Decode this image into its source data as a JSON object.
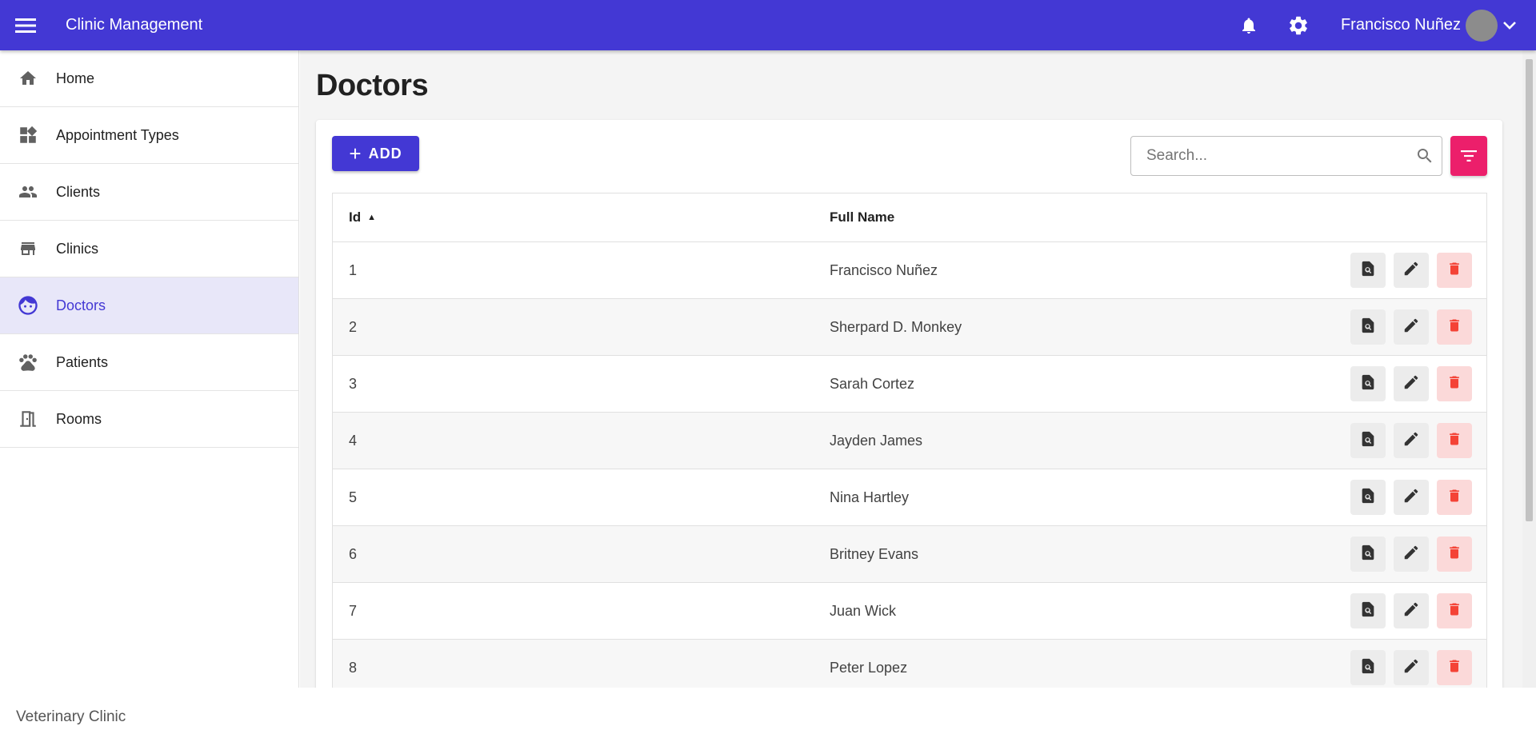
{
  "app": {
    "title": "Clinic Management"
  },
  "user": {
    "name": "Francisco Nuñez"
  },
  "sidebar": {
    "items": [
      {
        "label": "Home",
        "icon": "home-icon"
      },
      {
        "label": "Appointment Types",
        "icon": "widgets-icon"
      },
      {
        "label": "Clients",
        "icon": "people-icon"
      },
      {
        "label": "Clinics",
        "icon": "store-icon"
      },
      {
        "label": "Doctors",
        "icon": "face-icon",
        "active": true
      },
      {
        "label": "Patients",
        "icon": "paw-icon"
      },
      {
        "label": "Rooms",
        "icon": "door-icon"
      }
    ]
  },
  "page": {
    "title": "Doctors"
  },
  "toolbar": {
    "add_label": "ADD",
    "search_placeholder": "Search...",
    "search_value": ""
  },
  "table": {
    "columns": [
      "Id",
      "Full Name"
    ],
    "sort": {
      "column": "Id",
      "direction": "asc"
    },
    "rows": [
      {
        "id": "1",
        "name": "Francisco Nuñez"
      },
      {
        "id": "2",
        "name": "Sherpard D. Monkey"
      },
      {
        "id": "3",
        "name": "Sarah Cortez"
      },
      {
        "id": "4",
        "name": "Jayden James"
      },
      {
        "id": "5",
        "name": "Nina Hartley"
      },
      {
        "id": "6",
        "name": "Britney Evans"
      },
      {
        "id": "7",
        "name": "Juan Wick"
      },
      {
        "id": "8",
        "name": "Peter Lopez"
      }
    ]
  },
  "footer": {
    "text": "Veterinary Clinic"
  },
  "colors": {
    "primary": "#4338d4",
    "accent": "#ec1f6b",
    "danger": "#f44336",
    "active_bg": "#e8e7f9"
  }
}
